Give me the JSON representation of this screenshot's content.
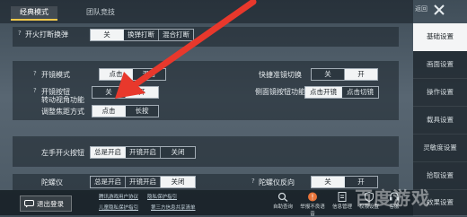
{
  "tabs": {
    "classic": "经典模式",
    "team": "团队竞技"
  },
  "corner_text": "返回",
  "settings": {
    "fire_interrupt": {
      "label": "开火打断换弹",
      "options": [
        "关",
        "换弹打断",
        "混合打断"
      ],
      "selected": 0
    },
    "scope_mode": {
      "label": "开镜模式",
      "options": [
        "点击",
        "混合"
      ],
      "selected": 0
    },
    "scope_button_turn": {
      "label_line1": "开镜按钮",
      "label_line2": "转动视角功能",
      "options": [
        "关",
        "开"
      ],
      "selected": 1
    },
    "focus_mode": {
      "label": "调整焦距方式",
      "options": [
        "点击",
        "长按"
      ],
      "selected": 0
    },
    "quick_scope_switch": {
      "label": "快捷准镜切换",
      "options": [
        "关",
        "开"
      ],
      "selected": 1
    },
    "side_scope_button": {
      "label": "侧面镜按钮功能",
      "options": [
        "点击开镜",
        "点击切镜"
      ],
      "selected": 0
    },
    "left_fire": {
      "label": "左手开火按钮",
      "options": [
        "总是开启",
        "开镜开启",
        "关闭"
      ],
      "selected": 0
    },
    "gyroscope": {
      "label": "陀螺仪",
      "options": [
        "总是开启",
        "开镜开启",
        "关闭"
      ],
      "selected": 2
    },
    "gyro_reverse": {
      "label": "陀螺仪反向",
      "options": [
        "关",
        "开"
      ],
      "selected": 0
    }
  },
  "sidebar": {
    "items": [
      "基础设置",
      "画面设置",
      "操作设置",
      "载具设置",
      "灵敏度设置",
      "拾取设置",
      "效果设置"
    ],
    "active": 0
  },
  "footer": {
    "logout": "退出登录",
    "links": [
      "腾讯游戏用户协议",
      "隐私保护指引",
      "儿童隐私保护指引",
      "第三方信息共享清单"
    ],
    "buttons": [
      "自助查询",
      "举报不良语音",
      "信息管理",
      "权限设置",
      "客服"
    ]
  },
  "watermark": "百度游戏",
  "colors": {
    "arrow": "#e8382c",
    "selected": "#f2f4f5",
    "tab_underline": "#f4c84b"
  }
}
